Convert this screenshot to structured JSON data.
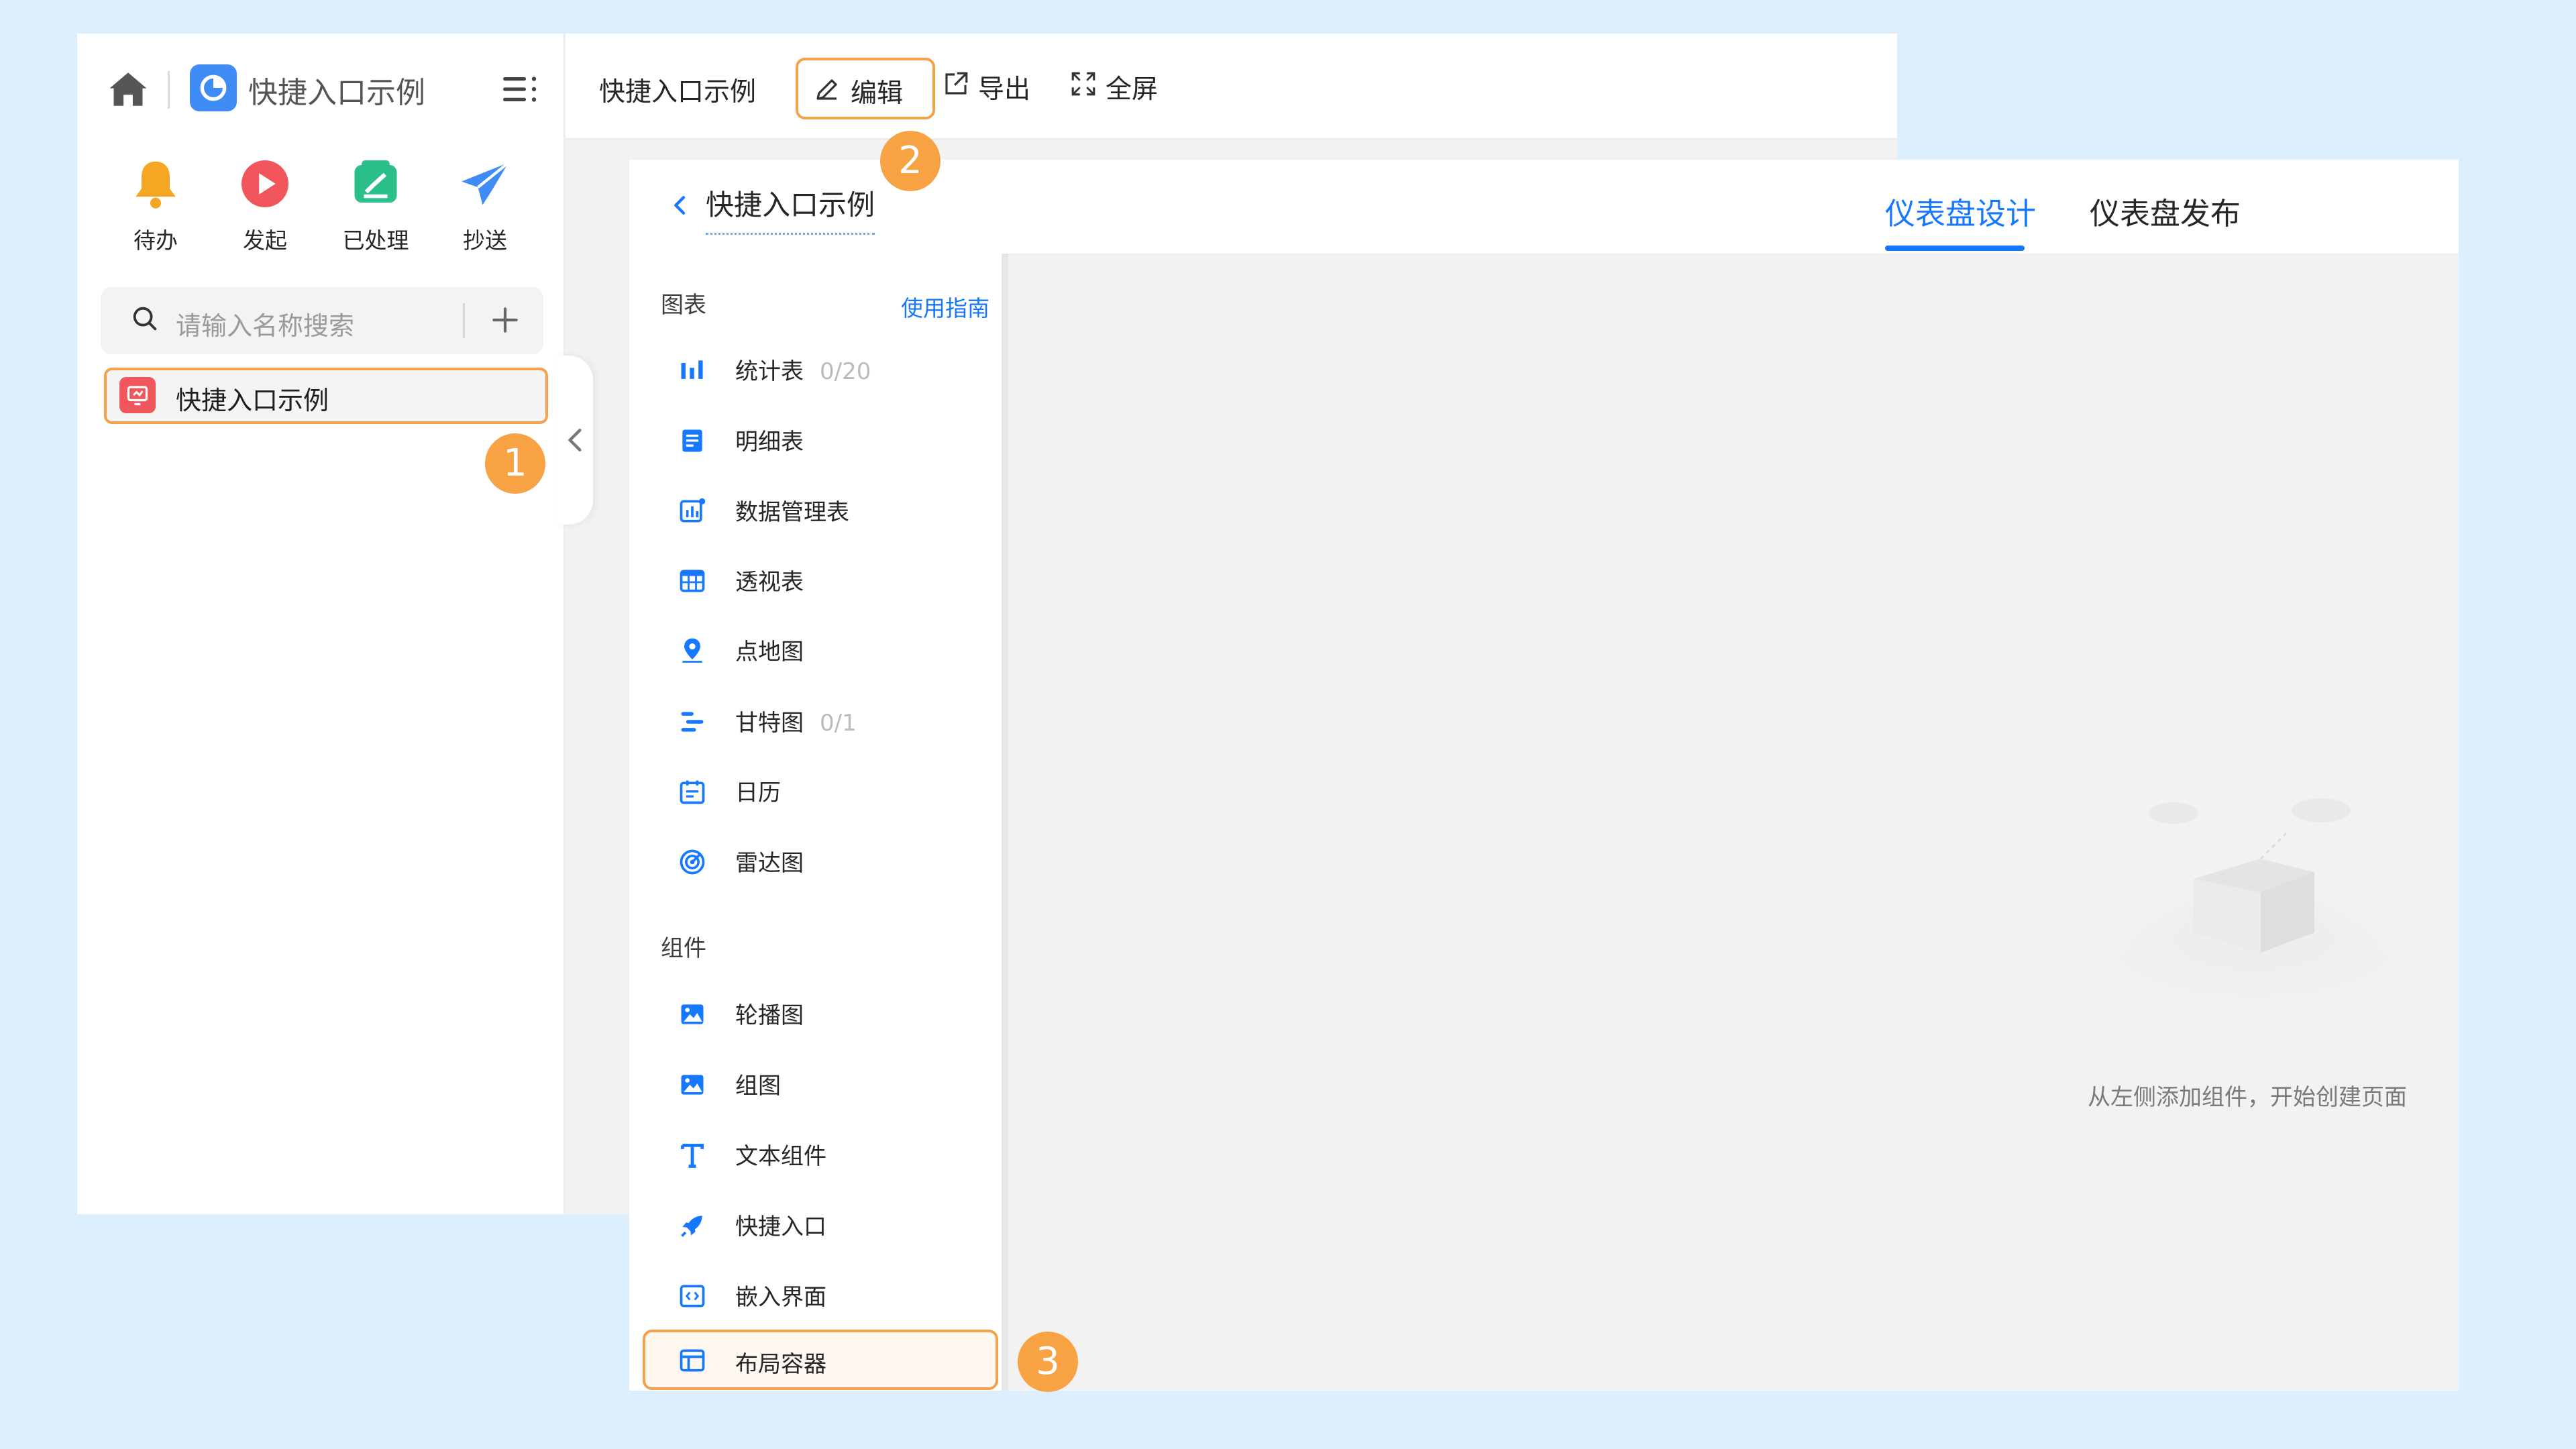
{
  "left_panel": {
    "app_title": "快捷入口示例",
    "quick_actions": [
      {
        "label": "待办",
        "icon": "bell-icon",
        "color": "#f5a623"
      },
      {
        "label": "发起",
        "icon": "play-icon",
        "color": "#f0565b"
      },
      {
        "label": "已处理",
        "icon": "done-icon",
        "color": "#2bbf8a"
      },
      {
        "label": "抄送",
        "icon": "send-icon",
        "color": "#3f8cf7"
      }
    ],
    "search_placeholder": "请输入名称搜索",
    "list": [
      {
        "label": "快捷入口示例"
      }
    ]
  },
  "top_bar": {
    "title": "快捷入口示例",
    "edit_label": "编辑",
    "export_label": "导出",
    "fullscreen_label": "全屏"
  },
  "badges": [
    "1",
    "2",
    "3"
  ],
  "designer": {
    "title": "快捷入口示例",
    "tabs": [
      {
        "label": "仪表盘设计",
        "active": true
      },
      {
        "label": "仪表盘发布",
        "active": false
      }
    ],
    "charts_section": {
      "title": "图表",
      "guide_link": "使用指南",
      "items": [
        {
          "label": "统计表",
          "count": "0/20",
          "icon": "bar-chart-icon"
        },
        {
          "label": "明细表",
          "icon": "detail-table-icon"
        },
        {
          "label": "数据管理表",
          "icon": "data-table-icon"
        },
        {
          "label": "透视表",
          "icon": "pivot-table-icon"
        },
        {
          "label": "点地图",
          "icon": "map-pin-icon"
        },
        {
          "label": "甘特图",
          "count": "0/1",
          "icon": "gantt-icon"
        },
        {
          "label": "日历",
          "icon": "calendar-icon"
        },
        {
          "label": "雷达图",
          "icon": "radar-icon"
        }
      ]
    },
    "components_section": {
      "title": "组件",
      "items": [
        {
          "label": "轮播图",
          "icon": "carousel-image-icon"
        },
        {
          "label": "组图",
          "icon": "image-group-icon"
        },
        {
          "label": "文本组件",
          "icon": "text-icon"
        },
        {
          "label": "快捷入口",
          "icon": "rocket-icon"
        },
        {
          "label": "嵌入界面",
          "icon": "embed-icon"
        },
        {
          "label": "布局容器",
          "icon": "layout-container-icon"
        }
      ]
    },
    "empty_hint": "从左侧添加组件，开始创建页面"
  },
  "colors": {
    "accent": "#1677ff",
    "highlight": "#f5a04a",
    "badge": "#f7a343",
    "background": "#ddeefc"
  }
}
